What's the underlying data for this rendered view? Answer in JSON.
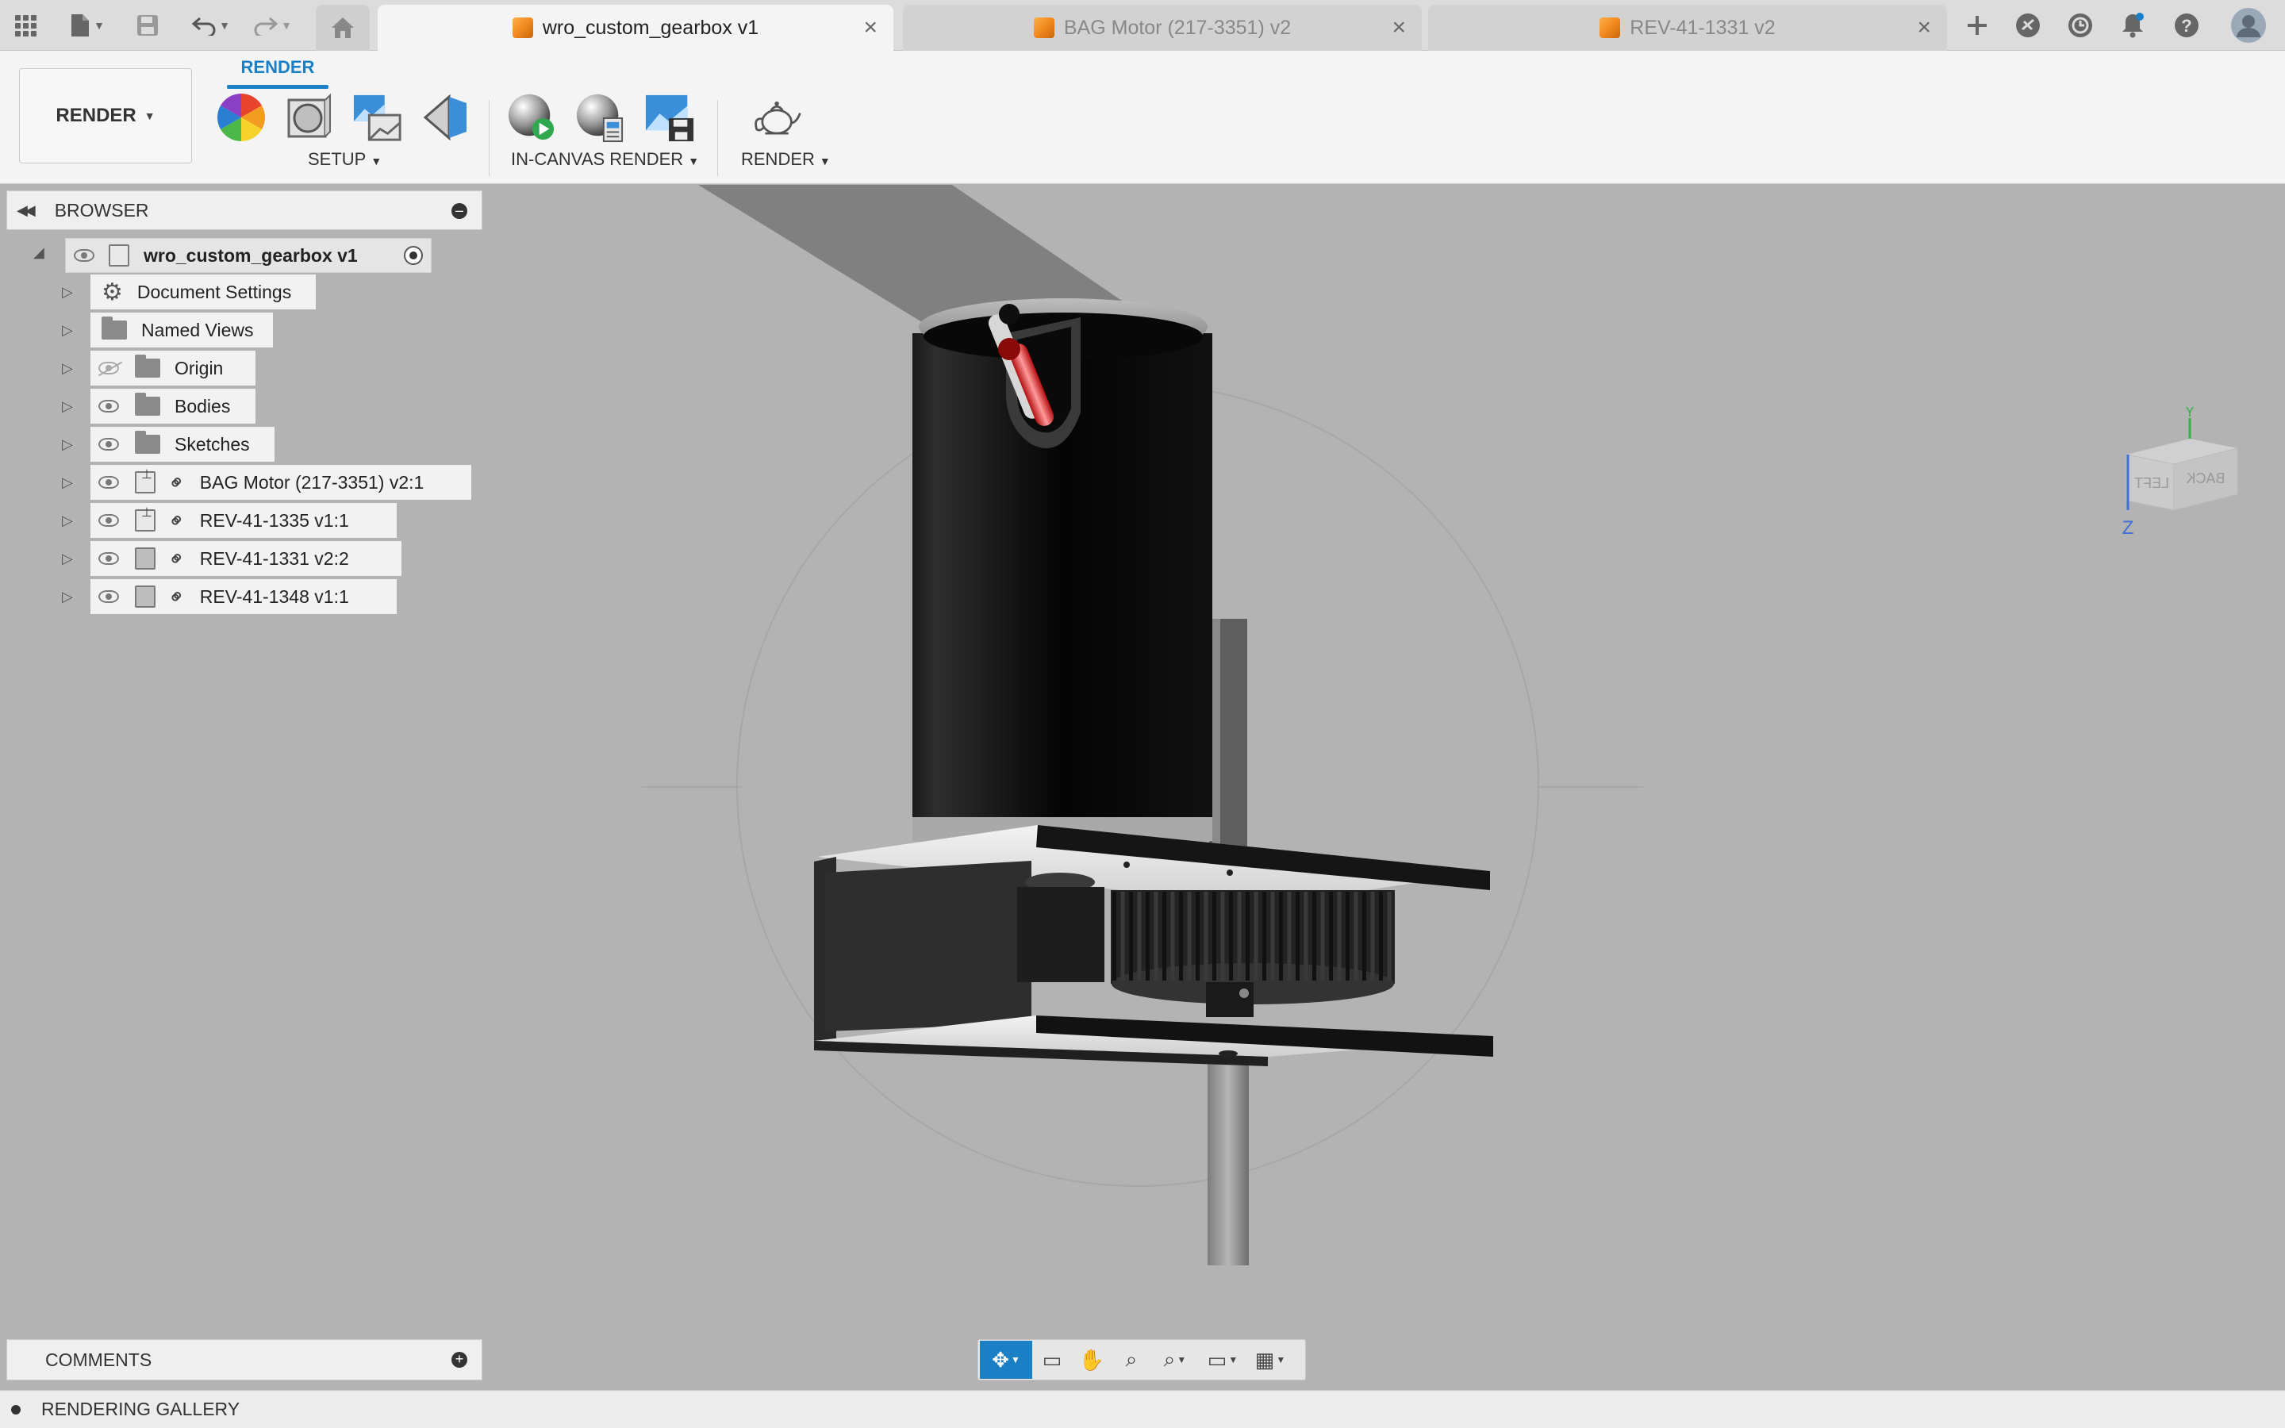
{
  "app_tabs": [
    {
      "label": "wro_custom_gearbox v1",
      "active": true
    },
    {
      "label": "BAG Motor (217-3351) v2",
      "active": false
    },
    {
      "label": "REV-41-1331 v2",
      "active": false
    }
  ],
  "toolbar": {
    "workspace": "RENDER",
    "ribbon_tab": "RENDER",
    "groups": {
      "setup": "SETUP",
      "in_canvas": "IN-CANVAS RENDER",
      "render": "RENDER"
    }
  },
  "browser": {
    "title": "BROWSER",
    "root": "wro_custom_gearbox v1",
    "items": [
      {
        "label": "Document Settings",
        "icon": "gear-icon"
      },
      {
        "label": "Named Views",
        "icon": "folder-icon"
      },
      {
        "label": "Origin",
        "icon": "folder-icon",
        "visible": false
      },
      {
        "label": "Bodies",
        "icon": "folder-icon"
      },
      {
        "label": "Sketches",
        "icon": "folder-icon"
      },
      {
        "label": "BAG Motor (217-3351) v2:1",
        "icon": "component-icon"
      },
      {
        "label": "REV-41-1335 v1:1",
        "icon": "component-icon"
      },
      {
        "label": "REV-41-1331 v2:2",
        "icon": "component-icon"
      },
      {
        "label": "REV-41-1348 v1:1",
        "icon": "component-icon"
      }
    ]
  },
  "viewcube": {
    "face_left": "LEFT",
    "face_back": "BACK",
    "axis_z": "Z",
    "axis_y": "Y"
  },
  "comments": {
    "title": "COMMENTS"
  },
  "statusbar": {
    "title": "RENDERING GALLERY"
  },
  "colors": {
    "accent": "#1a7fc4",
    "brand_orange": "#f08a1e",
    "viewport_bg": "#b3b3b3"
  }
}
